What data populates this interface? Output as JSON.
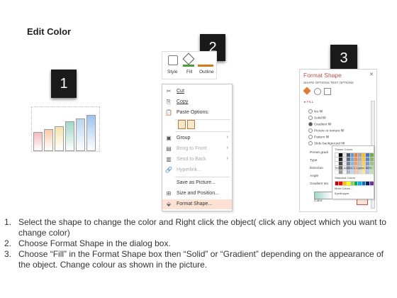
{
  "title": "Edit Color",
  "badges": [
    "1",
    "2",
    "3"
  ],
  "ribbon": {
    "labels": [
      "Style",
      "Fill",
      "Outline"
    ]
  },
  "context_menu": {
    "items": [
      {
        "icon": "cut-icon",
        "glyph": "✂",
        "label": "Cut",
        "disabled": false
      },
      {
        "icon": "copy-icon",
        "glyph": "⎘",
        "label": "Copy",
        "disabled": false
      },
      {
        "icon": "paste-icon",
        "glyph": "📋",
        "label": "Paste Options:",
        "disabled": false
      },
      {
        "icon": "group-icon",
        "glyph": "▣",
        "label": "Group",
        "disabled": false,
        "submenu": true
      },
      {
        "icon": "bring-to-front-icon",
        "glyph": "▤",
        "label": "Bring to Front",
        "disabled": true,
        "submenu": true
      },
      {
        "icon": "send-to-back-icon",
        "glyph": "▥",
        "label": "Send to Back",
        "disabled": true,
        "submenu": true
      },
      {
        "icon": "hyperlink-icon",
        "glyph": "🔗",
        "label": "Hyperlink...",
        "disabled": true
      },
      {
        "icon": "save-picture-icon",
        "glyph": "",
        "label": "Save as Picture...",
        "disabled": false
      },
      {
        "icon": "size-position-icon",
        "glyph": "⊞",
        "label": "Size and Position...",
        "disabled": false
      },
      {
        "icon": "format-shape-icon",
        "glyph": "⬙",
        "label": "Format Shape...",
        "disabled": false,
        "highlighted": true
      }
    ]
  },
  "format_pane": {
    "title": "Format Shape",
    "tabs": "SHAPE OPTIONS   TEXT OPTIONS",
    "section": "▸ FILL",
    "options": [
      "No fill",
      "Solid fill",
      "Gradient fill",
      "Picture or texture fill",
      "Pattern fill",
      "Slide background fill"
    ],
    "fields": [
      "Preset gradi",
      "Type",
      "Direction",
      "Angle",
      "Gradient sto"
    ],
    "color_label": "Color",
    "palette": {
      "theme_label": "Theme Colors",
      "tooltip": "Text 2, Accent 1, Lighter 80%",
      "standard_label": "Standard Colors",
      "more": "More Colors...",
      "eyedropper": "Eyedropper"
    }
  },
  "chart_colors": [
    "#f4b9c0",
    "#f9c9a8",
    "#f6e3a7",
    "#9ed6c8",
    "#b8d4f0",
    "#9cc4ef"
  ],
  "chart_levels": [
    0.4,
    0.5,
    0.6,
    0.75,
    0.86,
    0.97
  ],
  "instructions": [
    {
      "num": "1.",
      "text": "Select the shape to change the color and Right click the object( click any object which you want to change color)"
    },
    {
      "num": "2.",
      "text": "Choose Format Shape in the dialog box."
    },
    {
      "num": "3.",
      "text": "Choose “Fill” in the Format Shape box then “Solid” or “Gradient” depending on the appearance of the object. Change colour as shown in the picture."
    }
  ]
}
